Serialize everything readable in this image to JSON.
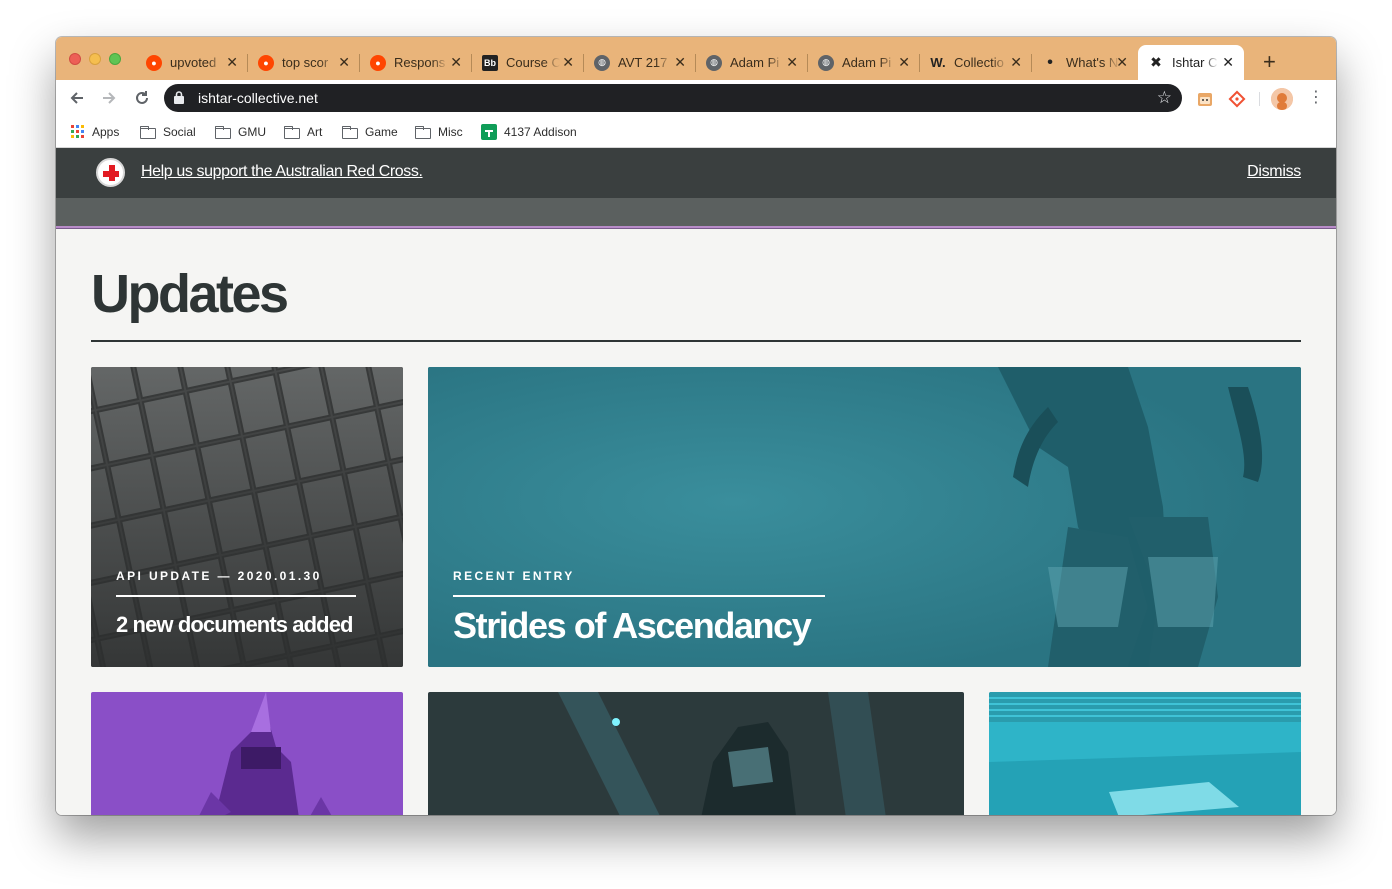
{
  "tabs": [
    {
      "title": "upvoted",
      "favicon": "reddit-icon",
      "color": "#ff4500"
    },
    {
      "title": "top scor",
      "favicon": "reddit-icon",
      "color": "#ff4500"
    },
    {
      "title": "Respons",
      "favicon": "reddit-icon",
      "color": "#ff4500"
    },
    {
      "title": "Course C",
      "favicon": "blackboard-icon",
      "color": "#222222"
    },
    {
      "title": "AVT 217",
      "favicon": "globe-icon",
      "color": "#5f6368"
    },
    {
      "title": "Adam Pi",
      "favicon": "globe-icon",
      "color": "#5f6368"
    },
    {
      "title": "Adam Pi",
      "favicon": "globe-icon",
      "color": "#5f6368"
    },
    {
      "title": "Collectio",
      "favicon": "w-icon",
      "color": "#222222"
    },
    {
      "title": "What's N",
      "favicon": "dot-icon",
      "color": "#222222"
    },
    {
      "title": "Ishtar Co",
      "favicon": "ishtar-icon",
      "color": "#222222"
    }
  ],
  "toolbar": {
    "url": "ishtar-collective.net"
  },
  "bookmarks": [
    {
      "label": "Apps",
      "icon": "apps-grid-icon"
    },
    {
      "label": "Social",
      "icon": "folder-icon"
    },
    {
      "label": "GMU",
      "icon": "folder-icon"
    },
    {
      "label": "Art",
      "icon": "folder-icon"
    },
    {
      "label": "Game",
      "icon": "folder-icon"
    },
    {
      "label": "Misc",
      "icon": "folder-icon"
    },
    {
      "label": "4137 Addison",
      "icon": "sheets-icon"
    }
  ],
  "banner": {
    "message": "Help us support the Australian Red Cross.",
    "dismiss": "Dismiss"
  },
  "page": {
    "heading": "Updates"
  },
  "cards": {
    "api": {
      "kicker": "API UPDATE — 2020.01.30",
      "title": "2 new documents added"
    },
    "recent": {
      "kicker": "RECENT ENTRY",
      "title": "Strides of Ascendancy"
    }
  },
  "colors": {
    "tabstrip": "#e9b47a",
    "teal": "#2b7c8a",
    "purple": "#8a4fc7",
    "banner": "#3a3f3f"
  }
}
